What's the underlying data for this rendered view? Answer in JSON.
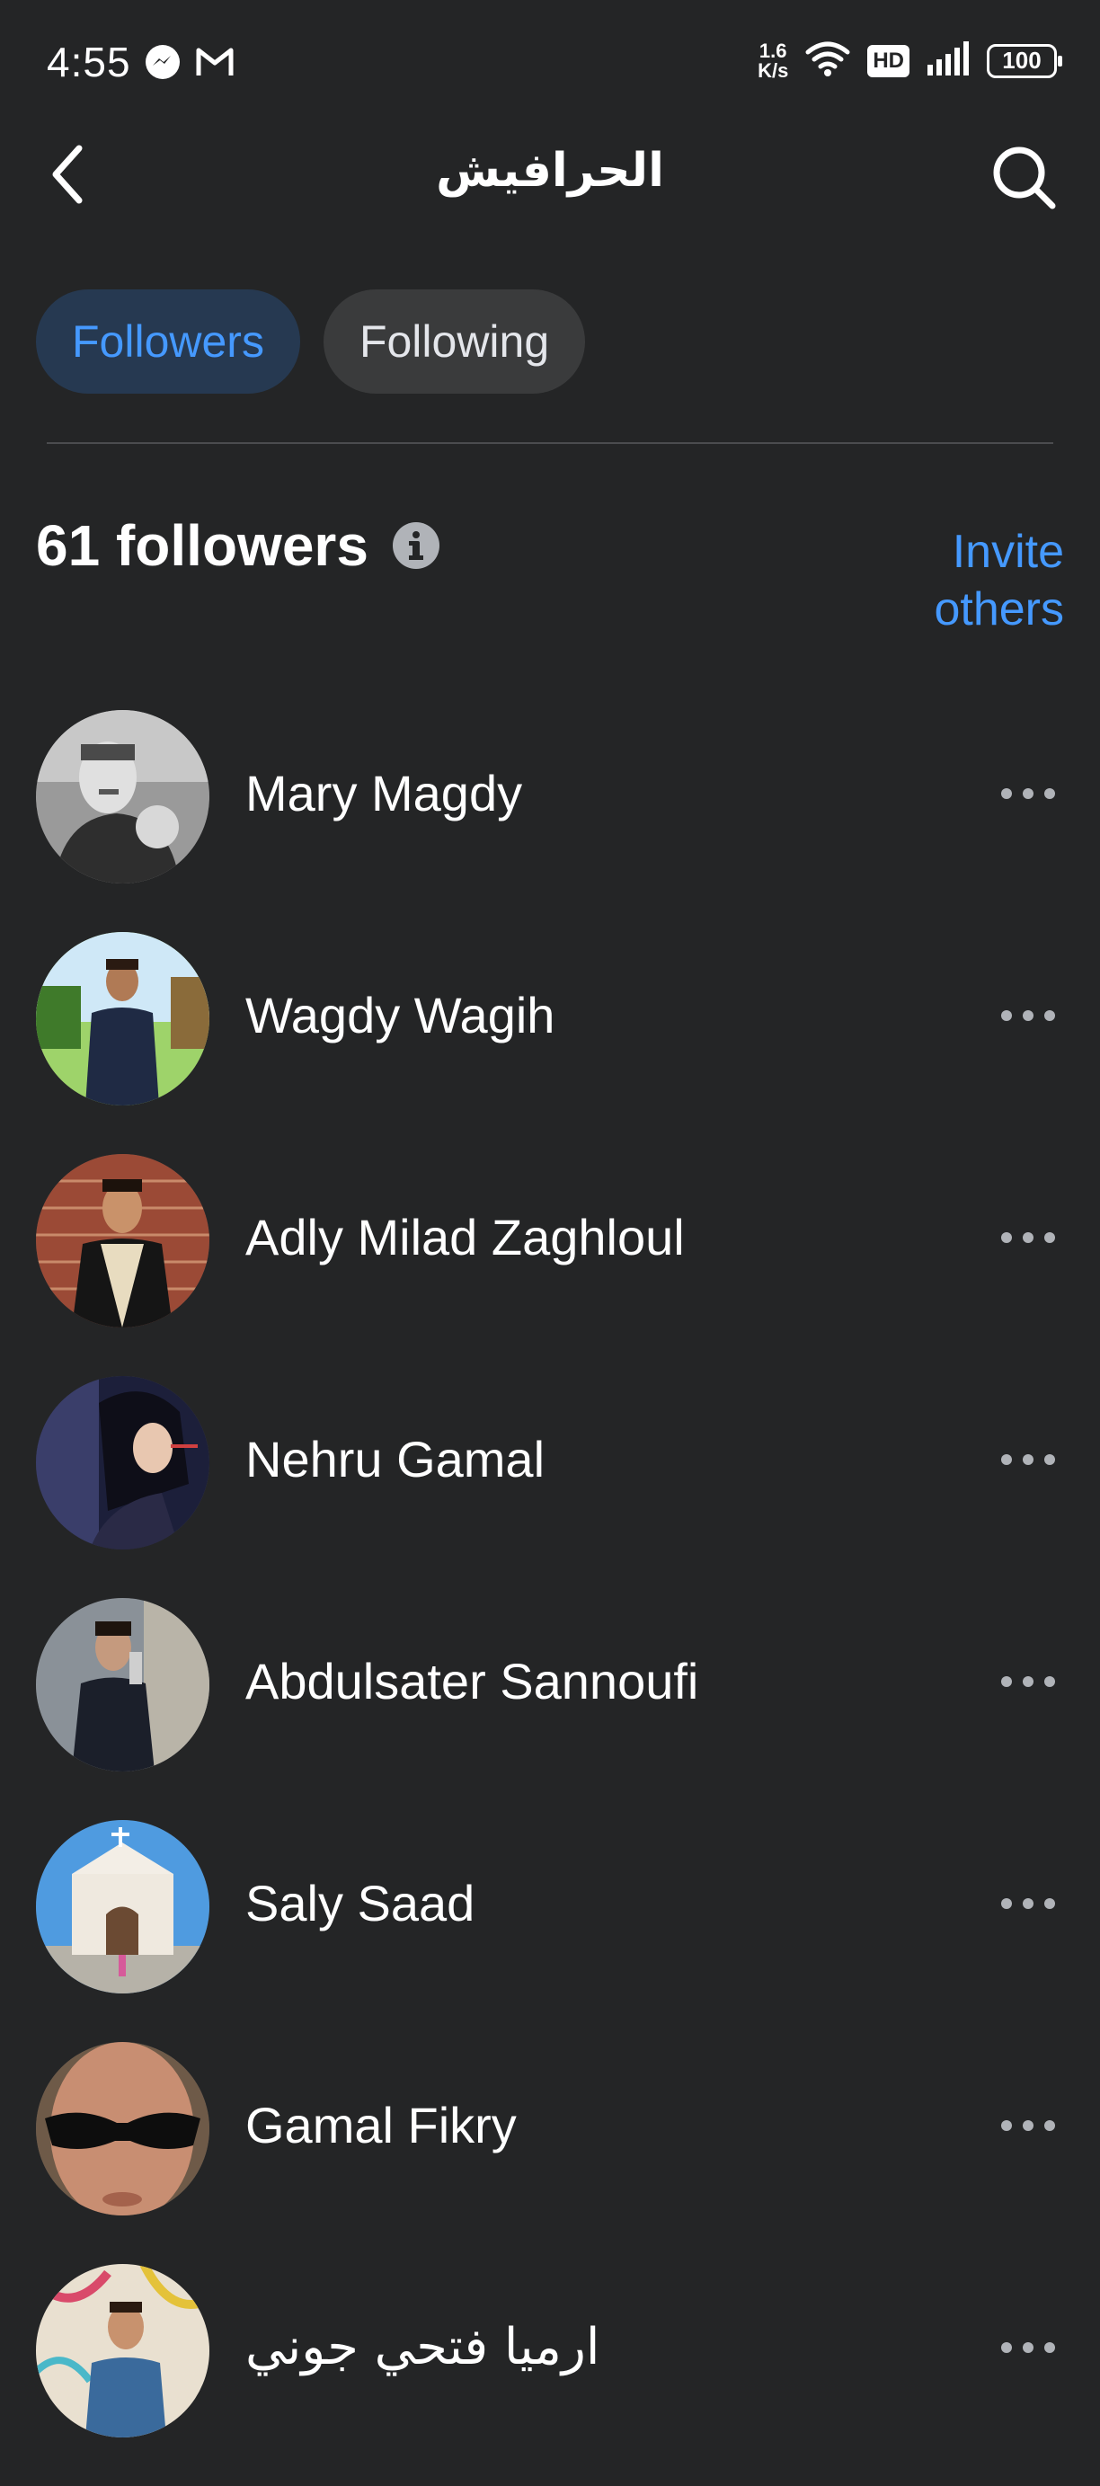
{
  "status_bar": {
    "time": "4:55",
    "net_speed_value": "1.6",
    "net_speed_unit": "K/s",
    "hd_label": "HD",
    "battery": "100"
  },
  "header": {
    "title": "الحرافيش"
  },
  "tabs": [
    {
      "label": "Followers",
      "active": true
    },
    {
      "label": "Following",
      "active": false
    }
  ],
  "summary": {
    "count_label": "61 followers",
    "invite_line1": "Invite",
    "invite_line2": "others"
  },
  "followers": [
    {
      "name": "Mary Magdy"
    },
    {
      "name": "Wagdy Wagih"
    },
    {
      "name": "Adly Milad Zaghloul"
    },
    {
      "name": "Nehru Gamal"
    },
    {
      "name": "Abdulsater Sannoufi"
    },
    {
      "name": "Saly Saad"
    },
    {
      "name": "Gamal Fikry"
    },
    {
      "name": "ارميا فتحي جوني"
    }
  ],
  "colors": {
    "background": "#242526",
    "accent": "#4599ff",
    "active_tab_bg": "#263951",
    "inactive_tab_bg": "#3a3b3c"
  },
  "icons": {
    "back": "chevron-left-icon",
    "search": "search-icon",
    "info": "info-icon",
    "more": "more-horizontal-icon",
    "messenger": "messenger-icon",
    "gmail": "gmail-icon",
    "wifi": "wifi-icon",
    "signal": "signal-icon"
  }
}
